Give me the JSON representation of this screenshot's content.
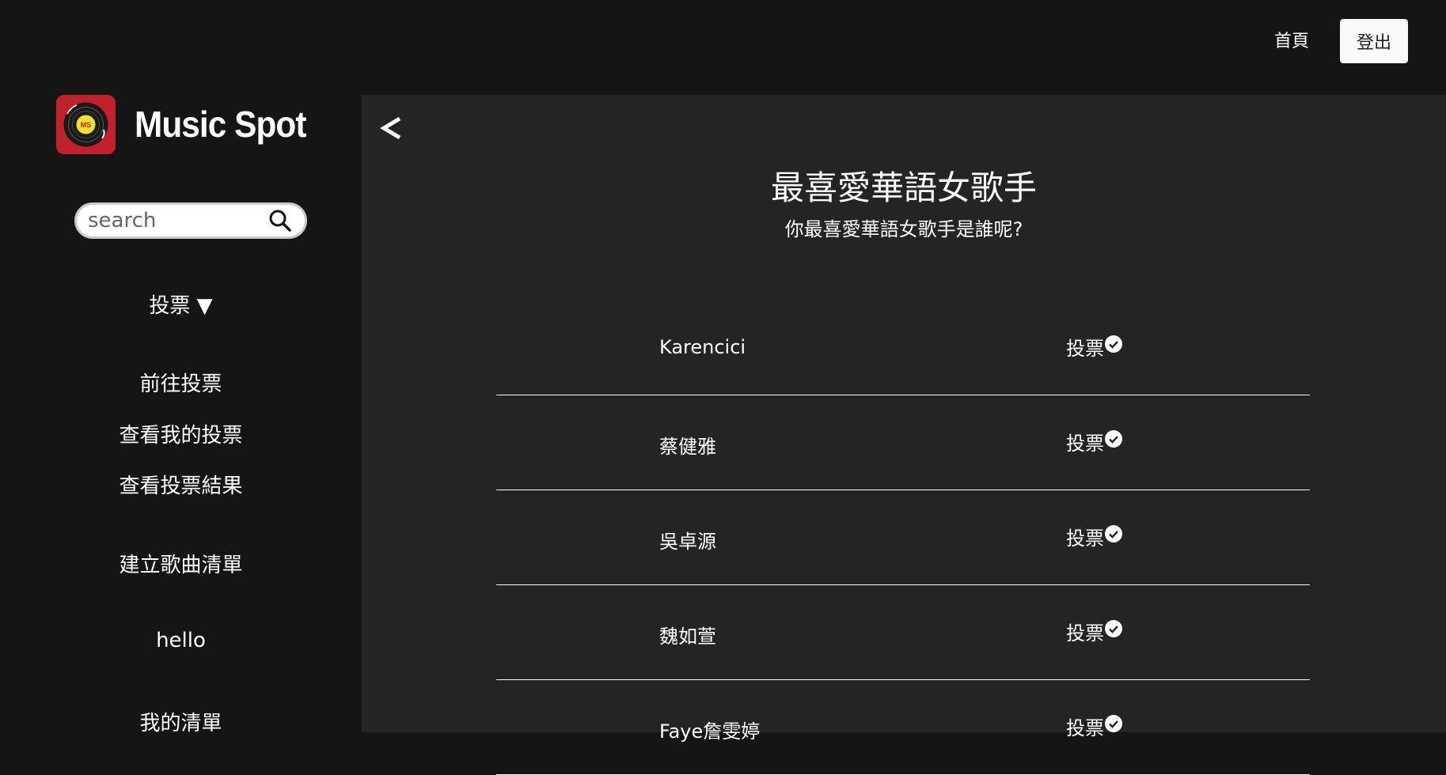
{
  "header": {
    "home_label": "首頁",
    "logout_label": "登出"
  },
  "brand": {
    "name": "Music Spot",
    "logo_icon": "vinyl-record-icon",
    "accent_color": "#c2202b"
  },
  "search": {
    "placeholder": "search",
    "icon": "search-icon"
  },
  "sidebar": {
    "vote_menu": "投票 ▼",
    "items": [
      {
        "label": "前往投票"
      },
      {
        "label": "查看我的投票"
      },
      {
        "label": "查看投票結果"
      },
      {
        "label": "建立歌曲清單"
      },
      {
        "label": "hello"
      },
      {
        "label": "我的清單"
      }
    ]
  },
  "vote": {
    "title": "最喜愛華語女歌手",
    "description": "你最喜愛華語女歌手是誰呢?",
    "vote_label": "投票",
    "candidates": [
      {
        "name": "Karencici"
      },
      {
        "name": "蔡健雅"
      },
      {
        "name": "吳卓源"
      },
      {
        "name": "魏如萱"
      },
      {
        "name": "Faye詹雯婷"
      }
    ]
  }
}
